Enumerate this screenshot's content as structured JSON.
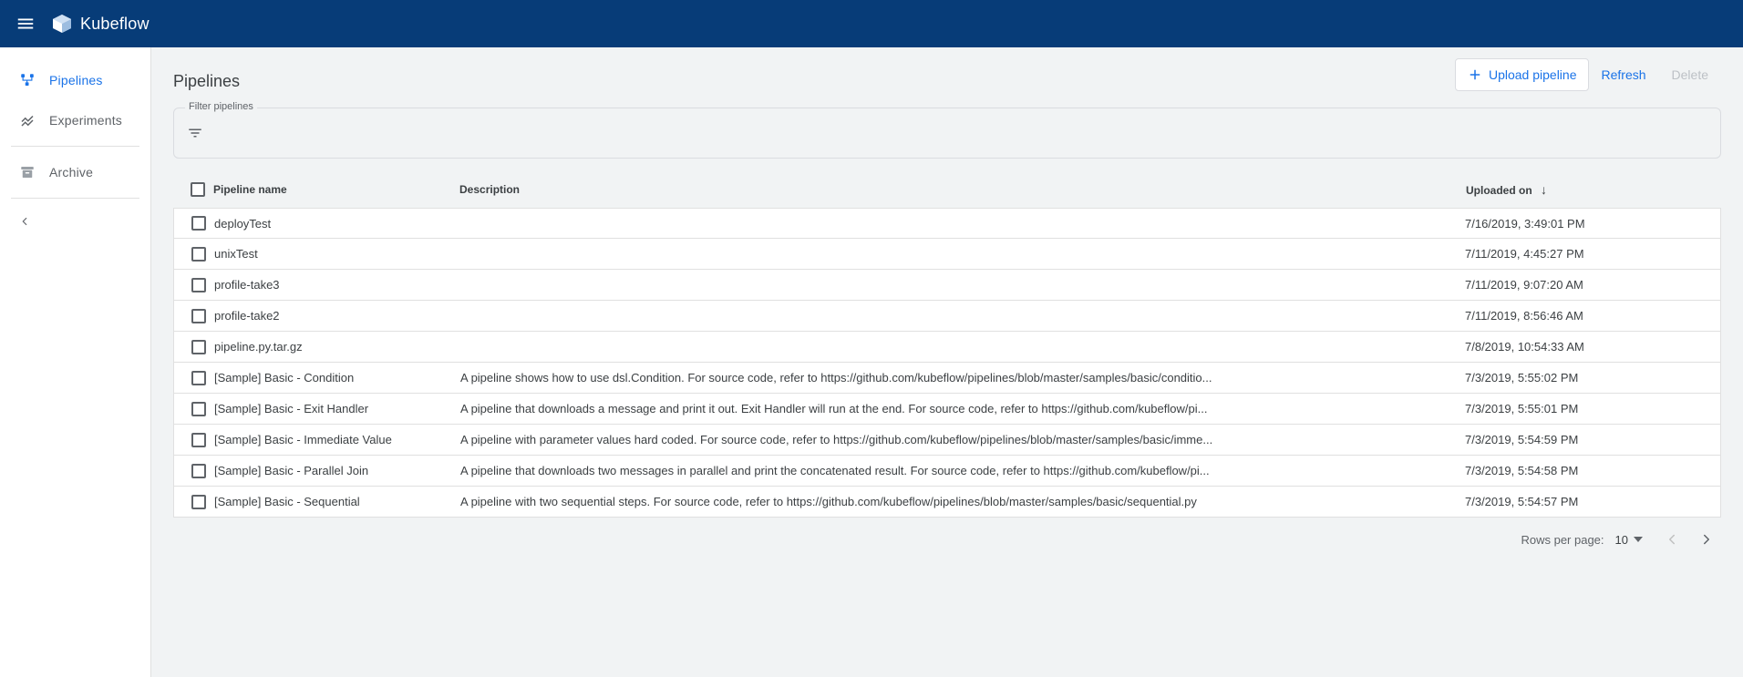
{
  "brand": {
    "name": "Kubeflow"
  },
  "sidebar": {
    "items": [
      {
        "label": "Pipelines"
      },
      {
        "label": "Experiments"
      },
      {
        "label": "Archive"
      }
    ]
  },
  "page": {
    "title": "Pipelines",
    "upload_label": "Upload pipeline",
    "refresh_label": "Refresh",
    "delete_label": "Delete",
    "filter_label": "Filter pipelines"
  },
  "table": {
    "headers": {
      "name": "Pipeline name",
      "description": "Description",
      "uploaded": "Uploaded on"
    },
    "rows": [
      {
        "name": "deployTest",
        "description": "",
        "uploaded": "7/16/2019, 3:49:01 PM"
      },
      {
        "name": "unixTest",
        "description": "",
        "uploaded": "7/11/2019, 4:45:27 PM"
      },
      {
        "name": "profile-take3",
        "description": "",
        "uploaded": "7/11/2019, 9:07:20 AM"
      },
      {
        "name": "profile-take2",
        "description": "",
        "uploaded": "7/11/2019, 8:56:46 AM"
      },
      {
        "name": "pipeline.py.tar.gz",
        "description": "",
        "uploaded": "7/8/2019, 10:54:33 AM"
      },
      {
        "name": "[Sample] Basic - Condition",
        "description": "A pipeline shows how to use dsl.Condition. For source code, refer to https://github.com/kubeflow/pipelines/blob/master/samples/basic/conditio...",
        "uploaded": "7/3/2019, 5:55:02 PM"
      },
      {
        "name": "[Sample] Basic - Exit Handler",
        "description": "A pipeline that downloads a message and print it out. Exit Handler will run at the end. For source code, refer to https://github.com/kubeflow/pi...",
        "uploaded": "7/3/2019, 5:55:01 PM"
      },
      {
        "name": "[Sample] Basic - Immediate Value",
        "description": "A pipeline with parameter values hard coded. For source code, refer to https://github.com/kubeflow/pipelines/blob/master/samples/basic/imme...",
        "uploaded": "7/3/2019, 5:54:59 PM"
      },
      {
        "name": "[Sample] Basic - Parallel Join",
        "description": "A pipeline that downloads two messages in parallel and print the concatenated result. For source code, refer to https://github.com/kubeflow/pi...",
        "uploaded": "7/3/2019, 5:54:58 PM"
      },
      {
        "name": "[Sample] Basic - Sequential",
        "description": "A pipeline with two sequential steps. For source code, refer to https://github.com/kubeflow/pipelines/blob/master/samples/basic/sequential.py",
        "uploaded": "7/3/2019, 5:54:57 PM"
      }
    ],
    "footer": {
      "rows_per_page_label": "Rows per page:",
      "rows_per_page_value": "10"
    }
  }
}
